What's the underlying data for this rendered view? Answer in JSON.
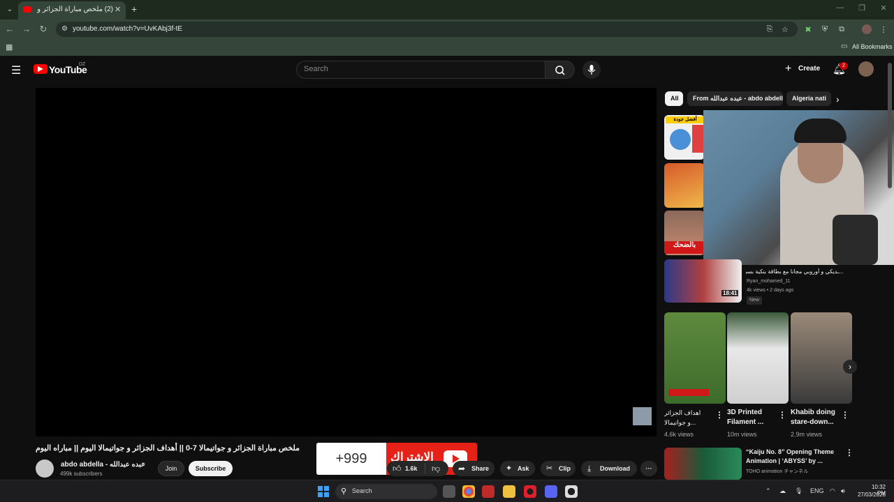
{
  "browser": {
    "tab_title": "(2) ملخص مباراة الجزائر و جواتيما",
    "url": "youtube.com/watch?v=UvKAbj3f-tE",
    "bookmarks_label": "All Bookmarks"
  },
  "header": {
    "logo_text": "YouTube",
    "country": "DZ",
    "search_placeholder": "Search",
    "create_label": "Create",
    "notifications_count": "2"
  },
  "player": {
    "banner_count": "+999",
    "banner_text": "الاشتراك"
  },
  "video": {
    "title": "ملخص مباراة الجزائر و جواتيمالا 7-0 || أهداف الجزائر و جواتيمالا اليوم || مباراه اليوم",
    "channel_name": "abdo abdella - عبده عبدالله",
    "subscribers": "499k subscribers",
    "join_label": "Join",
    "subscribe_label": "Subscribe",
    "likes": "1.6k",
    "share_label": "Share",
    "ask_label": "Ask",
    "clip_label": "Clip",
    "download_label": "Download"
  },
  "chips": [
    "All",
    "From عبده عبدالله - abdo abdella",
    "Algeria nati"
  ],
  "sidebar": {
    "thumb_badges": [
      "أفضل جودة",
      "بالضحك"
    ],
    "rec4": {
      "title": "...ـديكي و أوروبي مجانا مع بطاقة بنكية بسر",
      "channel": "Ryan_mohamed_11",
      "meta": "4k views • 2 days ago",
      "badge": "New",
      "duration": "18:41"
    },
    "shorts": [
      {
        "title": "اهداف الجزائر ...و جواتيمالا اليوم",
        "views": "4.6k views"
      },
      {
        "title": "3D Printed Filament ...",
        "views": "10m views"
      },
      {
        "title": "Khabib doing stare-down...",
        "views": "2.9m views"
      }
    ],
    "rec5": {
      "title": "“Kaiju No. 8” Opening Theme Animation | ‘ABYSS’ by ...",
      "channel": "TOHO animation チャンネル"
    }
  },
  "taskbar": {
    "search_label": "Search",
    "lang": "ENG",
    "time": "10:32 PM",
    "date": "27/03/2026"
  },
  "colors": {
    "yt_red": "#ff0000",
    "chrome_green": "#35453a",
    "subscribe_red": "#e62117"
  }
}
